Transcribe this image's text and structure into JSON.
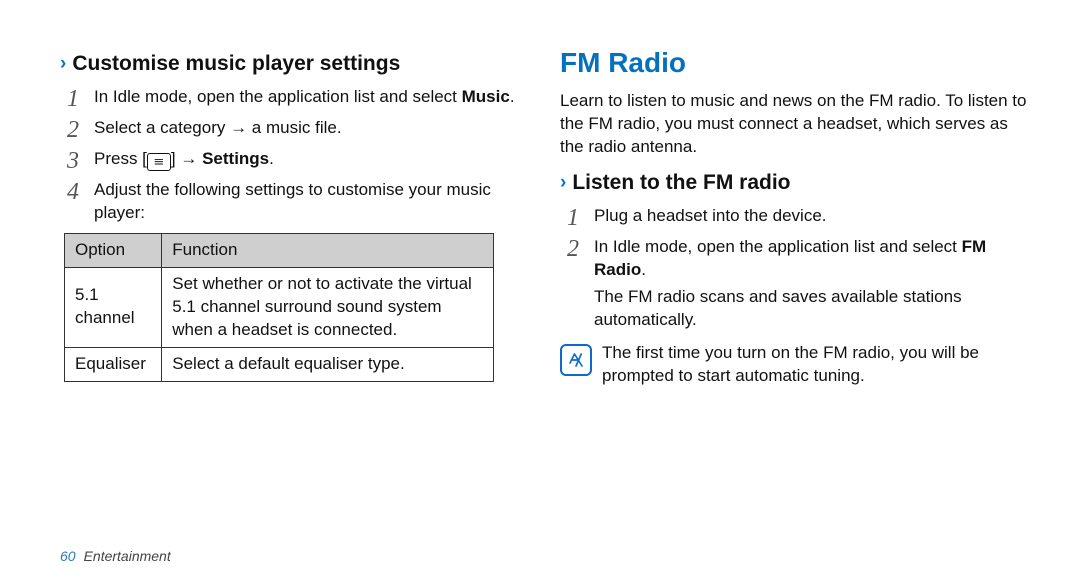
{
  "left": {
    "heading": "Customise music player settings",
    "steps": [
      {
        "pre": "In Idle mode, open the application list and select ",
        "bold": "Music",
        "post": "."
      },
      {
        "pre": "Select a category → a music file.",
        "bold": "",
        "post": ""
      },
      {
        "pre": "Press [",
        "icon": true,
        "mid": "] → ",
        "bold": "Settings",
        "post": "."
      },
      {
        "pre": "Adjust the following settings to customise your music player:",
        "bold": "",
        "post": ""
      }
    ],
    "table": {
      "headers": [
        "Option",
        "Function"
      ],
      "rows": [
        [
          "5.1 channel",
          "Set whether or not to activate the virtual 5.1 channel surround sound system when a headset is connected."
        ],
        [
          "Equaliser",
          "Select a default equaliser type."
        ]
      ]
    }
  },
  "right": {
    "title": "FM Radio",
    "intro": "Learn to listen to music and news on the FM radio. To listen to the FM radio, you must connect a headset, which serves as the radio antenna.",
    "heading": "Listen to the FM radio",
    "steps": [
      {
        "pre": "Plug a headset into the device.",
        "bold": "",
        "post": ""
      },
      {
        "pre": "In Idle mode, open the application list and select ",
        "bold": "FM Radio",
        "post": "."
      }
    ],
    "sub_para": "The FM radio scans and saves available stations automatically.",
    "note": "The first time you turn on the FM radio, you will be prompted to start automatic tuning."
  },
  "footer": {
    "page": "60",
    "section": "Entertainment"
  }
}
